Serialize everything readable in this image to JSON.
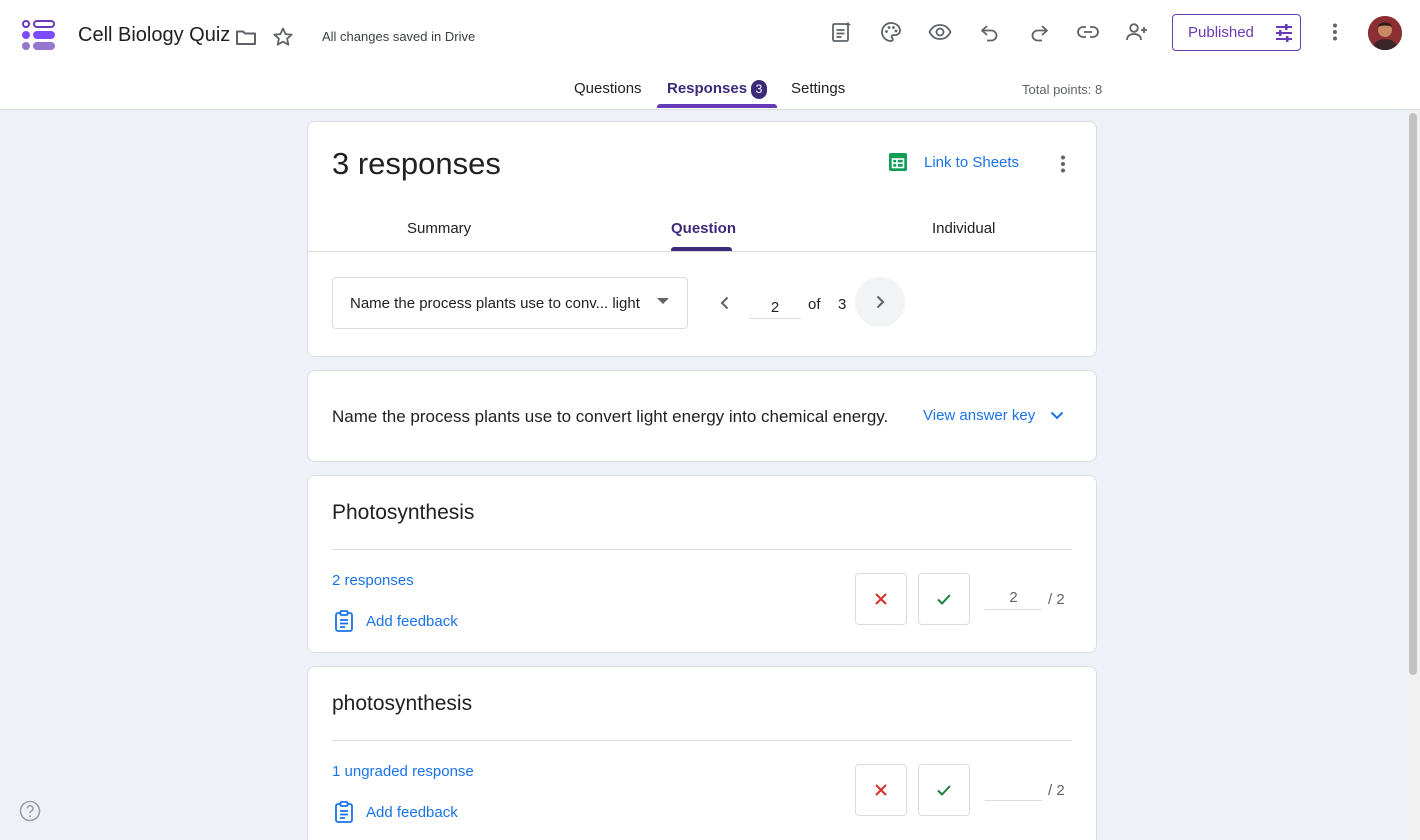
{
  "app": {
    "title": "Cell Biology Quiz",
    "save_status": "All changes saved in Drive",
    "publish_label": "Published",
    "accent_color": "#673ab7",
    "link_color": "#1a73e8"
  },
  "toolbar": {
    "icons": [
      "customize-form-icon",
      "palette-icon",
      "preview-eye-icon",
      "undo-icon",
      "redo-icon",
      "link-icon",
      "add-collaborator-icon",
      "more-vert-icon"
    ]
  },
  "tabs": {
    "questions": "Questions",
    "responses": "Responses",
    "responses_count": "3",
    "settings": "Settings",
    "active": "Responses"
  },
  "total_points": "Total points: 8",
  "responses": {
    "title": "3 responses",
    "link_sheets": "Link to Sheets",
    "subtabs": {
      "summary": "Summary",
      "question": "Question",
      "individual": "Individual",
      "active": "Question"
    },
    "question_select": "Name the process plants use to conv... light",
    "pager": {
      "current": "2",
      "of": "of",
      "total": "3"
    }
  },
  "question": {
    "text": "Name the process plants use to convert light energy into chemical energy.",
    "answer_key_label": "View answer key"
  },
  "answers": [
    {
      "text": "Photosynthesis",
      "count_label": "2 responses",
      "feedback_label": "Add feedback",
      "score": "2",
      "max": "/  2"
    },
    {
      "text": "photosynthesis",
      "count_label": "1 ungraded response",
      "feedback_label": "Add feedback",
      "score": "",
      "max": "/  2"
    }
  ]
}
